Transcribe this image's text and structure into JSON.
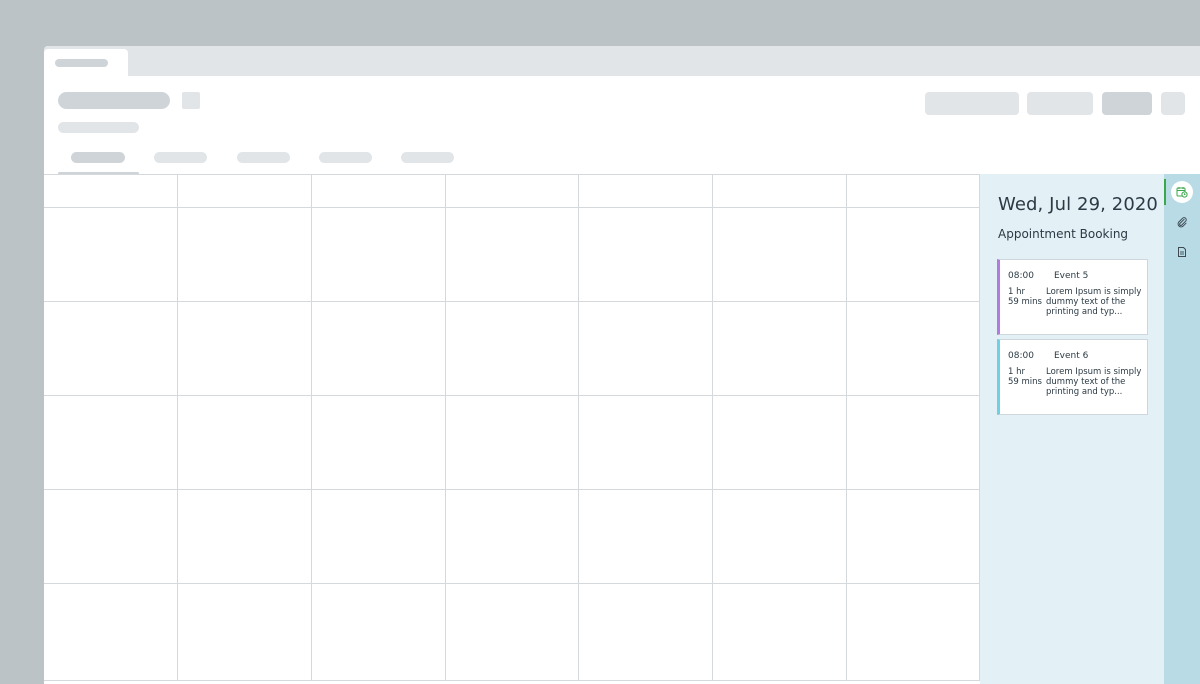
{
  "panel": {
    "date": "Wed, Jul 29, 2020",
    "subtitle": "Appointment Booking",
    "events": [
      {
        "time": "08:00",
        "name": "Event 5",
        "duration_line1": "1 hr",
        "duration_line2": "59 mins",
        "description": "Lorem Ipsum is simply dummy text of the printing and typ...",
        "accent": "#b07ce0"
      },
      {
        "time": "08:00",
        "name": "Event 6",
        "duration_line1": "1 hr",
        "duration_line2": "59 mins",
        "description": "Lorem Ipsum is simply dummy text of the printing and typ...",
        "accent": "#6ed0e3"
      }
    ]
  },
  "rail": {
    "icons": [
      "calendar-clock-icon",
      "paperclip-icon",
      "document-icon"
    ],
    "active_color": "#3aa84a"
  },
  "colors": {
    "backdrop": "#bcc3c7",
    "panel_bg": "#e3f1f6",
    "rail_bg": "#b8dbe6",
    "skeleton": "#e1e5e8",
    "skeleton_dark": "#cfd4d8"
  }
}
